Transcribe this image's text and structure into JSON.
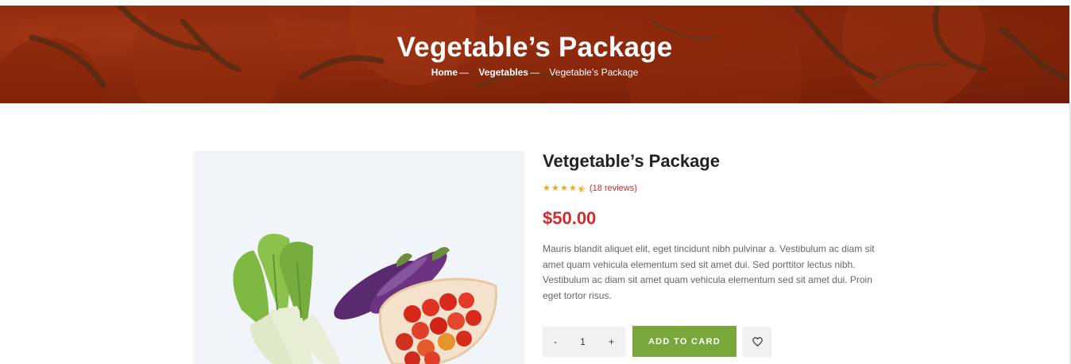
{
  "hero": {
    "title": "Vegetable’s Package",
    "breadcrumb": {
      "home": "Home",
      "category": "Vegetables",
      "separator": "—",
      "current": "Vegetable’s Package"
    }
  },
  "product": {
    "title": "Vetgetable’s Package",
    "rating": 4.5,
    "reviews_label": "(18 reviews)",
    "price": "$50.00",
    "description": "Mauris blandit aliquet elit, eget tincidunt nibh pulvinar a. Vestibulum ac diam sit amet quam vehicula elementum sed sit amet dui. Sed porttitor lectus nibh. Vestibulum ac diam sit amet quam vehicula elementum sed sit amet dui. Proin eget tortor risus."
  },
  "cart": {
    "minus_label": "-",
    "quantity": "1",
    "plus_label": "+",
    "add_label": "ADD TO CARD",
    "wishlist_icon": "heart-icon"
  },
  "colors": {
    "accent_green": "#7aa73b",
    "price_red": "#d22b2b",
    "star_gold": "#f3a712"
  }
}
